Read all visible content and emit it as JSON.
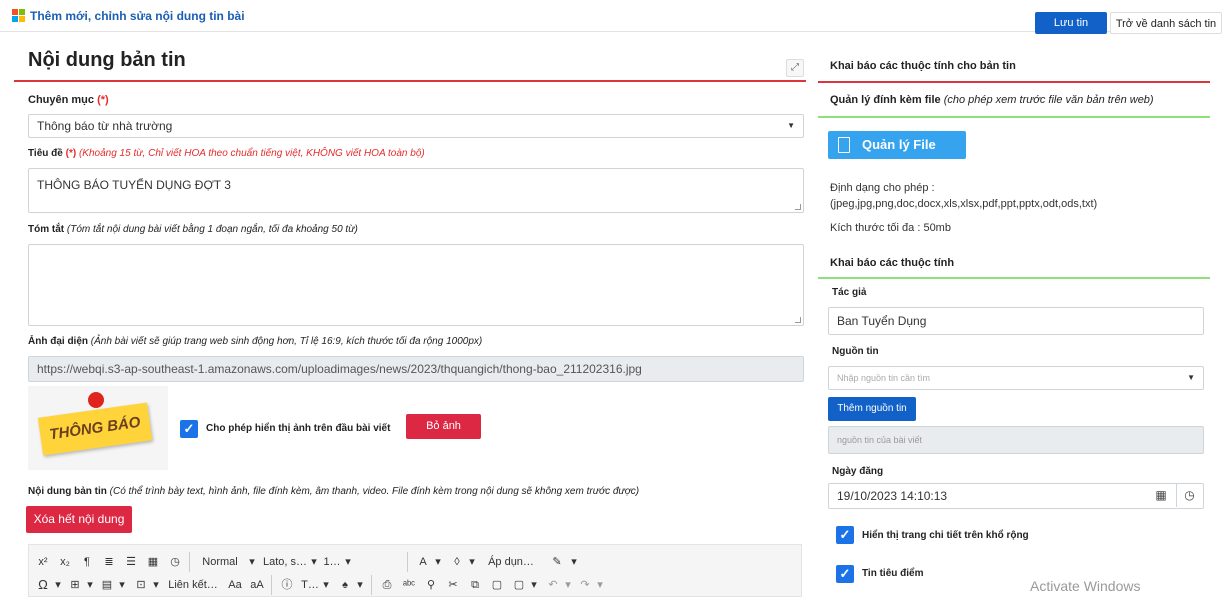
{
  "header": {
    "title": "Thêm mới, chỉnh sửa nội dung tin bài",
    "save_label": "Lưu tin",
    "back_label": "Trở về danh sách tin"
  },
  "left": {
    "heading": "Nội dung bản tin",
    "category": {
      "label": "Chuyên mục",
      "required": "(*)",
      "value": "Thông  báo từ nhà trường"
    },
    "title_field": {
      "label": "Tiêu đề",
      "required": "(*)",
      "hint": "(Khoảng 15 từ, Chỉ viết HOA theo chuẩn tiếng việt, KHÔNG viết HOA toàn bộ)",
      "value": "THÔNG BÁO TUYỂN DỤNG ĐỢT 3"
    },
    "summary": {
      "label": "Tóm tắt",
      "hint": "(Tóm tắt nội dung bài viết bằng 1 đoạn ngắn, tối đa khoảng 50 từ)",
      "value": ""
    },
    "avatar": {
      "label": "Ảnh đại diện",
      "hint": "(Ảnh bài viết sẽ giúp trang web sinh động hơn, Tỉ lệ 16:9, kích thước tối đa rộng 1000px)",
      "url": "https://webqi.s3-ap-southeast-1.amazonaws.com/uploadimages/news/2023/thquangich/thong-bao_211202316.jpg",
      "image_text": "THÔNG BÁO",
      "show_label": "Cho phép hiển thị ảnh trên đầu bài viết",
      "remove_label": "Bỏ ảnh"
    },
    "content": {
      "label": "Nội dung bản tin",
      "hint": "(Có thể trình bày text, hình ảnh, file đính kèm, âm thanh, video. File đính kèm trong nội dung sẽ không xem trước được)",
      "clear_label": "Xóa hết nội dung"
    },
    "toolbar": {
      "format": "Normal",
      "font": "Lato, s…",
      "size": "1…",
      "apply": "Áp dụn…",
      "link": "Liên kết…",
      "text": "T…"
    }
  },
  "right": {
    "heading": "Khai báo các thuộc tính cho bản tin",
    "attach": {
      "title": "Quản lý đính kèm file",
      "hint": "(cho phép xem trước file văn bản trên web)",
      "button": "Quản lý File",
      "formats_label": "Định dạng cho phép :",
      "formats": "(jpeg,jpg,png,doc,docx,xls,xlsx,pdf,ppt,pptx,odt,ods,txt)",
      "max_size": "Kích thước tối đa : 50mb"
    },
    "props": {
      "title": "Khai báo các thuộc tính",
      "author_label": "Tác giả",
      "author_value": "Ban Tuyển Dụng",
      "source_label": "Nguồn tin",
      "source_placeholder": "Nhập nguồn tin cần tìm",
      "add_source": "Thêm nguồn tin",
      "source_list_placeholder": "nguồn tin của bài viết",
      "date_label": "Ngày đăng",
      "date_value": "19/10/2023 14:10:13",
      "wide_label": "Hiển thị trang chi tiết trên khổ rộng",
      "featured_label": "Tin tiêu điểm"
    }
  },
  "watermark": "Activate Windows"
}
